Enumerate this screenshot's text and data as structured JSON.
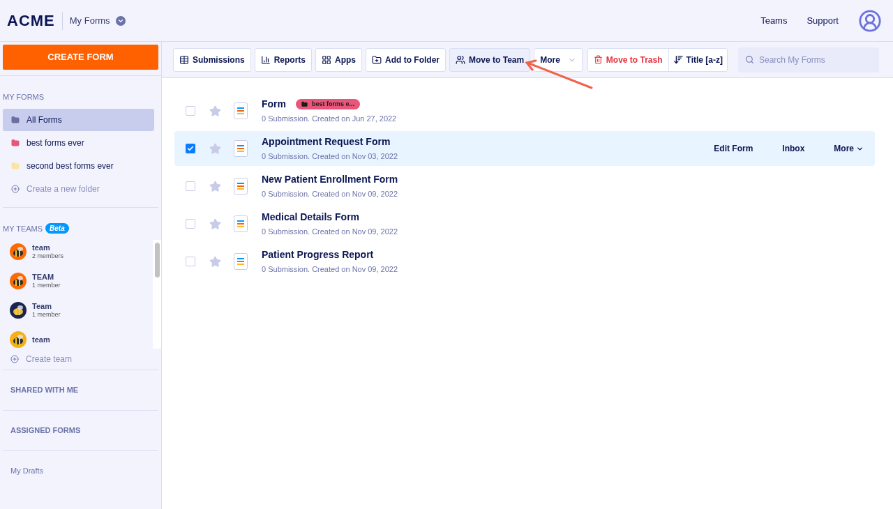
{
  "header": {
    "logo": "ACME",
    "section": "My Forms",
    "links": [
      "Teams",
      "Support"
    ]
  },
  "sidebar": {
    "create_button": "CREATE FORM",
    "my_forms_heading": "MY FORMS",
    "folders": [
      {
        "label": "All Forms",
        "selected": true,
        "color": "#6b6f9e"
      },
      {
        "label": "best forms ever",
        "selected": false,
        "color": "#e8577a"
      },
      {
        "label": "second best forms ever",
        "selected": false,
        "color": "#fbe3a0"
      }
    ],
    "create_folder": "Create a new folder",
    "teams_heading": "MY TEAMS",
    "teams_badge": "Beta",
    "teams": [
      {
        "name": "team",
        "members": "2 members"
      },
      {
        "name": "TEAM",
        "members": "1 member"
      },
      {
        "name": "Team",
        "members": "1 member"
      },
      {
        "name": "team"
      }
    ],
    "create_team": "Create team",
    "sections": [
      "SHARED WITH ME",
      "ASSIGNED FORMS"
    ],
    "drafts": "My Drafts"
  },
  "toolbar": {
    "buttons": [
      {
        "label": "Submissions",
        "selected": false
      },
      {
        "label": "Reports",
        "selected": false
      },
      {
        "label": "Apps",
        "selected": false
      },
      {
        "label": "Add to Folder",
        "selected": false
      },
      {
        "label": "Move to Team",
        "selected": true
      },
      {
        "label": "More",
        "selected": false
      }
    ],
    "trash": "Move to Trash",
    "sort": "Title [a-z]",
    "search": {
      "placeholder": "Search My Forms"
    }
  },
  "forms": [
    {
      "title": "Form",
      "tag": {
        "label": "best forms e...",
        "color": "#e8577a"
      },
      "meta": "0 Submission. Created on Jun 27, 2022",
      "checked": false,
      "starred": false,
      "selected": false
    },
    {
      "title": "Appointment Request Form",
      "meta": "0 Submission. Created on Nov 03, 2022",
      "checked": true,
      "starred": false,
      "selected": true,
      "actions": [
        "Edit Form",
        "Inbox",
        "More"
      ]
    },
    {
      "title": "New Patient Enrollment Form",
      "meta": "0 Submission. Created on Nov 09, 2022",
      "checked": false,
      "starred": false,
      "selected": false
    },
    {
      "title": "Medical Details Form",
      "meta": "0 Submission. Created on Nov 09, 2022",
      "checked": false,
      "starred": false,
      "selected": false
    },
    {
      "title": "Patient Progress Report",
      "meta": "0 Submission. Created on Nov 09, 2022",
      "checked": false,
      "starred": false,
      "selected": false
    }
  ]
}
